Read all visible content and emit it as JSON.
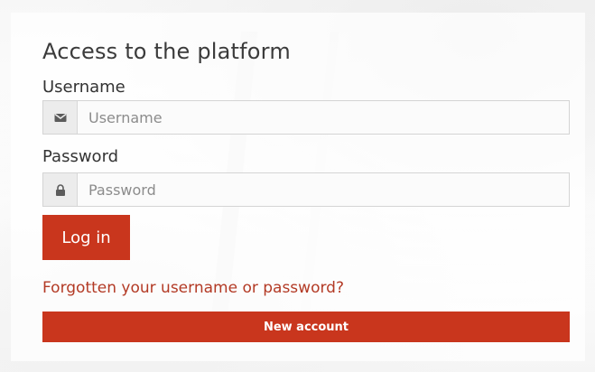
{
  "form": {
    "title": "Access to the platform",
    "username_label": "Username",
    "username_placeholder": "Username",
    "username_value": "",
    "password_label": "Password",
    "password_placeholder": "Password",
    "password_value": "",
    "login_label": "Log in",
    "forgot_label": "Forgotten your username or password?",
    "new_account_label": "New account"
  },
  "icons": {
    "username": "envelope-icon",
    "password": "lock-icon"
  },
  "colors": {
    "accent": "#c9361d",
    "link": "#b33a25",
    "text": "#333333"
  }
}
